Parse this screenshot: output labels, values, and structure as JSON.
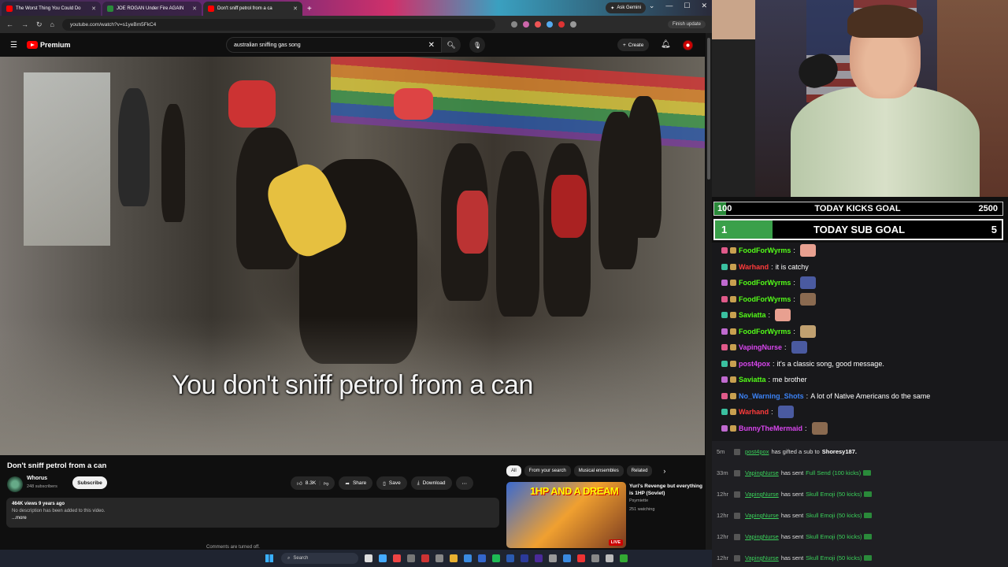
{
  "browser": {
    "tabs": [
      {
        "title": "The Worst Thing You Could Do",
        "active": false
      },
      {
        "title": "JOE ROGAN Under Fire AGAIN",
        "active": false
      },
      {
        "title": "Don't sniff petrol from a ca",
        "active": true
      }
    ],
    "new_tab": "+",
    "ask_gemini": "Ask Gemini",
    "url": "youtube.com/watch?v=s1yeBm5FkC4",
    "finish_update": "Finish update"
  },
  "youtube": {
    "logo_text": "Premium",
    "search_query": "australian sniffing gas song",
    "create_label": "Create",
    "subtitle": "You don't sniff petrol from a can",
    "video_title": "Don't sniff petrol from a can",
    "channel_name": "Whorus",
    "subscribers": "248 subscribers",
    "subscribe_label": "Subscribe",
    "likes": "8.3K",
    "share_label": "Share",
    "save_label": "Save",
    "download_label": "Download",
    "desc_meta": "464K views  9 years ago",
    "desc_text": "No description has been added to this video.",
    "desc_more": "...more",
    "comments_off": "Comments are turned off.",
    "chips": [
      "All",
      "From your search",
      "Musical ensembles",
      "Related"
    ],
    "rec": {
      "thumb_text": "1HP AND A DREAM",
      "live": "LIVE",
      "title": "Yuri's Revenge but everything is 1HP (Soviet)",
      "channel": "Psymiette",
      "watching": "251 watching"
    }
  },
  "taskbar": {
    "search_label": "Search"
  },
  "goals": {
    "kicks": {
      "current": "100",
      "label": "TODAY KICKS GOAL",
      "target": "2500",
      "progress": 0.04
    },
    "subs": {
      "current": "1",
      "label": "TODAY SUB GOAL",
      "target": "5",
      "progress": 0.2
    }
  },
  "chat": [
    {
      "user": "FoodForWyrms",
      "color": "#53fc18",
      "text": "",
      "emote": true
    },
    {
      "user": "Warhand",
      "color": "#ff3b3b",
      "text": "it is catchy",
      "emote": false
    },
    {
      "user": "FoodForWyrms",
      "color": "#53fc18",
      "text": "",
      "emote": true
    },
    {
      "user": "FoodForWyrms",
      "color": "#53fc18",
      "text": "",
      "emote": true
    },
    {
      "user": "Saviatta",
      "color": "#53fc18",
      "text": "",
      "emote": true
    },
    {
      "user": "FoodForWyrms",
      "color": "#53fc18",
      "text": "",
      "emote": true
    },
    {
      "user": "VapingNurse",
      "color": "#d946ef",
      "text": "",
      "emote": true
    },
    {
      "user": "post4pox",
      "color": "#d946ef",
      "text": "it's a classic song, good message.",
      "emote": false
    },
    {
      "user": "Saviatta",
      "color": "#53fc18",
      "text": "me brother",
      "emote": false
    },
    {
      "user": "No_Warning_Shots",
      "color": "#3b82f6",
      "text": "A lot of Native Americans do the same",
      "emote": false
    },
    {
      "user": "Warhand",
      "color": "#ff3b3b",
      "text": "",
      "emote": true
    },
    {
      "user": "BunnyTheMermaid",
      "color": "#d946ef",
      "text": "",
      "emote": true
    }
  ],
  "events": [
    {
      "time": "5m",
      "user": "post4pox",
      "action": "has gifted a sub to",
      "target": "Shoresy187.",
      "gift": ""
    },
    {
      "time": "33m",
      "user": "VapingNurse",
      "action": "has sent",
      "target": "",
      "gift": "Full Send (100 kicks)"
    },
    {
      "time": "12hr",
      "user": "VapingNurse",
      "action": "has sent",
      "target": "",
      "gift": "Skull Emoji (50 kicks)"
    },
    {
      "time": "12hr",
      "user": "VapingNurse",
      "action": "has sent",
      "target": "",
      "gift": "Skull Emoji (50 kicks)"
    },
    {
      "time": "12hr",
      "user": "VapingNurse",
      "action": "has sent",
      "target": "",
      "gift": "Skull Emoji (50 kicks)"
    },
    {
      "time": "12hr",
      "user": "VapingNurse",
      "action": "has sent",
      "target": "",
      "gift": "Skull Emoji (50 kicks)"
    }
  ]
}
